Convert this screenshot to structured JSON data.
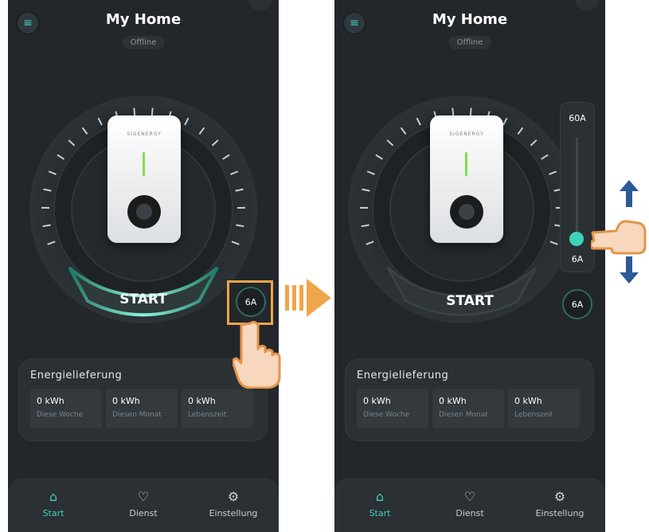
{
  "app": {
    "title": "My Home",
    "status": "Offline"
  },
  "control": {
    "start_label": "START",
    "current_value": "6A"
  },
  "slider": {
    "max_label": "60A",
    "min_label": "6A",
    "level": 0.0
  },
  "energy": {
    "title": "Energielieferung",
    "stats": [
      {
        "value": "0 kWh",
        "label": "Diese Woche"
      },
      {
        "value": "0 kWh",
        "label": "Diesen Monat"
      },
      {
        "value": "0 kWh",
        "label": "Lebenszeit"
      }
    ]
  },
  "nav": [
    {
      "label": "Start",
      "icon": "home-icon",
      "active": true
    },
    {
      "label": "Dienst",
      "icon": "service-heart-icon",
      "active": false
    },
    {
      "label": "Einstellung",
      "icon": "gear-icon",
      "active": false
    }
  ],
  "brand": {
    "text": "SIGENERGY"
  },
  "colors": {
    "accent": "#3fd0b8",
    "highlight": "#f0a54a",
    "arrow_blue": "#2d5a96",
    "background": "#23272b"
  }
}
